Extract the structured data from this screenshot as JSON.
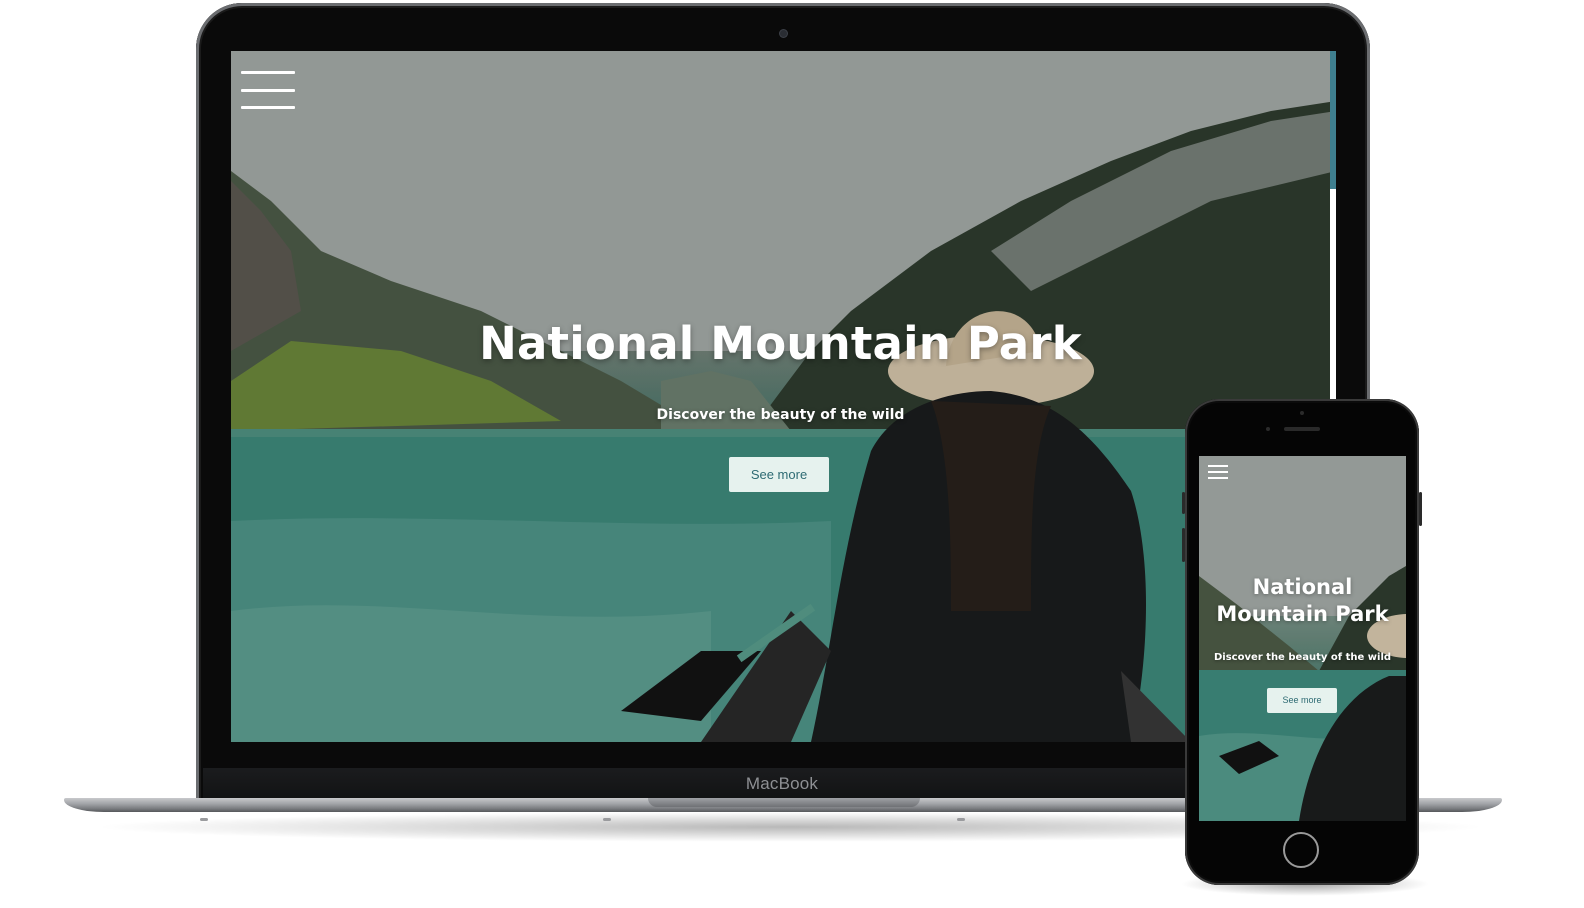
{
  "laptop": {
    "brand": "MacBook",
    "hero": {
      "title": "National Mountain Park",
      "subtitle": "Discover the beauty of the wild",
      "button_label": "See more",
      "menu_icon": "hamburger-menu-icon"
    }
  },
  "phone": {
    "hero": {
      "title": "National Mountain Park",
      "subtitle": "Discover the beauty of the wild",
      "button_label": "See more",
      "menu_icon": "hamburger-menu-icon"
    }
  },
  "colors": {
    "button_bg": "#e6f2ee",
    "button_text": "#2e6b73",
    "scroll_thumb": "#3f7f8f",
    "lake": "#3e8a7d"
  }
}
